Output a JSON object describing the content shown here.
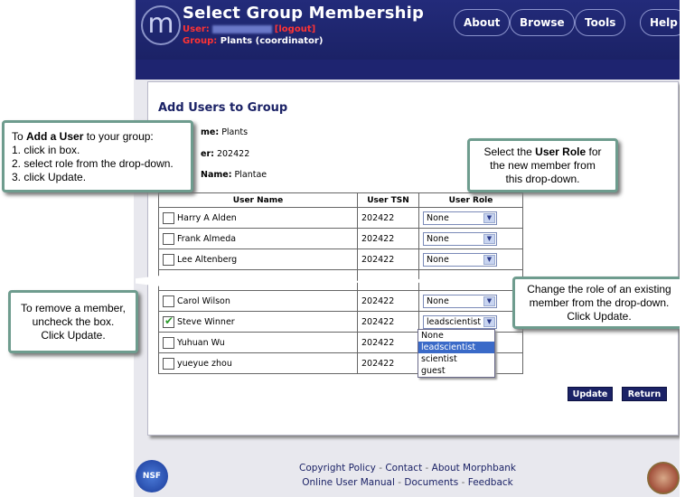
{
  "header": {
    "title": "Select Group Membership",
    "user_label": "User:",
    "logout_label": "[logout]",
    "group_label": "Group:",
    "group_value": "Plants (coordinator)",
    "nav": [
      "About",
      "Browse",
      "Tools",
      "Help"
    ]
  },
  "main": {
    "section_title": "Add Users to Group",
    "info": {
      "group_name_label": "me:",
      "group_name_value": "Plants",
      "tsn_label": "er:",
      "tsn_value": "202422",
      "taxon_label": "Name:",
      "taxon_value": "Plantae"
    },
    "table": {
      "headers": [
        "User Name",
        "User TSN",
        "User Role"
      ],
      "rows_top": [
        {
          "name": "Harry A Alden",
          "tsn": "202422",
          "role": "None",
          "checked": false
        },
        {
          "name": "Frank Almeda",
          "tsn": "202422",
          "role": "None",
          "checked": false
        },
        {
          "name": "Lee Altenberg",
          "tsn": "202422",
          "role": "None",
          "checked": false
        }
      ],
      "rows_bottom": [
        {
          "name": "Carol Wilson",
          "tsn": "202422",
          "role": "None",
          "checked": false
        },
        {
          "name": "Steve Winner",
          "tsn": "202422",
          "role": "leadscientist",
          "checked": true
        },
        {
          "name": "Yuhuan Wu",
          "tsn": "202422",
          "role": "",
          "checked": false
        },
        {
          "name": "yueyue zhou",
          "tsn": "202422",
          "role": "",
          "checked": false
        }
      ]
    },
    "dropdown_options": [
      "None",
      "leadscientist",
      "scientist",
      "guest"
    ],
    "dropdown_selected": "leadscientist",
    "buttons": {
      "update": "Update",
      "return": "Return"
    }
  },
  "callouts": {
    "add_user": {
      "line1_pre": "To ",
      "line1_bold": "Add a User",
      "line1_post": " to your group:",
      "steps": [
        "1. click in box.",
        "2. select role from the drop-down.",
        "3. click Update."
      ]
    },
    "user_role": {
      "pre": "Select the ",
      "bold": "User Role",
      "post": " for",
      "line2": "the new member from",
      "line3": "this drop-down."
    },
    "remove": {
      "line1": "To remove a member,",
      "line2": "uncheck the box.",
      "line3": "Click Update."
    },
    "change_role": {
      "line1": "Change the role of an existing",
      "line2": "member from the drop-down.",
      "line3": "Click Update."
    }
  },
  "footer": {
    "row1": [
      "Copyright Policy",
      "Contact",
      "About Morphbank"
    ],
    "row2": [
      "Online User Manual",
      "Documents",
      "Feedback"
    ],
    "separator": "-",
    "nsf_label": "NSF"
  },
  "colors": {
    "header_bg": "#1b2266",
    "callout_border": "#6e9c8e",
    "group_label": "#ff3333",
    "highlight": "#3a6ac8"
  }
}
